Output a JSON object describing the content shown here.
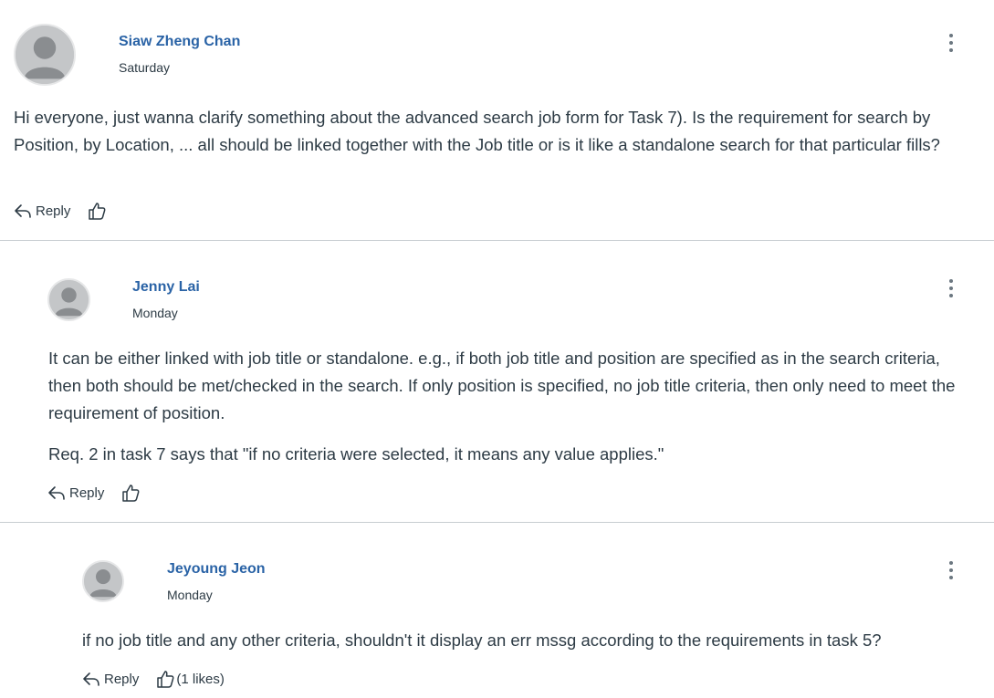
{
  "posts": [
    {
      "author": "Siaw Zheng Chan",
      "date": "Saturday",
      "body": [
        "Hi everyone, just wanna clarify something about the advanced search job form for Task 7). Is the requirement for search by Position, by Location, ... all should be linked together with the Job title or is it like a standalone search for that particular fills?"
      ],
      "reply_label": "Reply",
      "likes_label": ""
    },
    {
      "author": "Jenny Lai",
      "date": "Monday",
      "body": [
        "It can be either linked with job title or standalone. e.g., if both job title and position are specified as in the search criteria, then both should be met/checked in the search. If only position is specified, no job title criteria, then only need to meet the requirement of position.",
        "Req. 2 in task 7 says that \"if no criteria were selected, it means any value applies.\""
      ],
      "reply_label": "Reply",
      "likes_label": ""
    },
    {
      "author": "Jeyoung Jeon",
      "date": "Monday",
      "body": [
        "if no job title and any other criteria, shouldn't it display an err mssg according to the requirements in task 5?"
      ],
      "reply_label": "Reply",
      "likes_label": "(1 likes)"
    }
  ],
  "icons": {
    "avatar": "user-avatar-placeholder",
    "more": "kebab-menu-icon",
    "reply": "reply-arrow-icon",
    "like": "thumbs-up-icon"
  },
  "colors": {
    "author_link": "#2a63a6",
    "text": "#2d3b45",
    "divider": "#c7cdd1",
    "avatar": "#c4c6c8"
  }
}
